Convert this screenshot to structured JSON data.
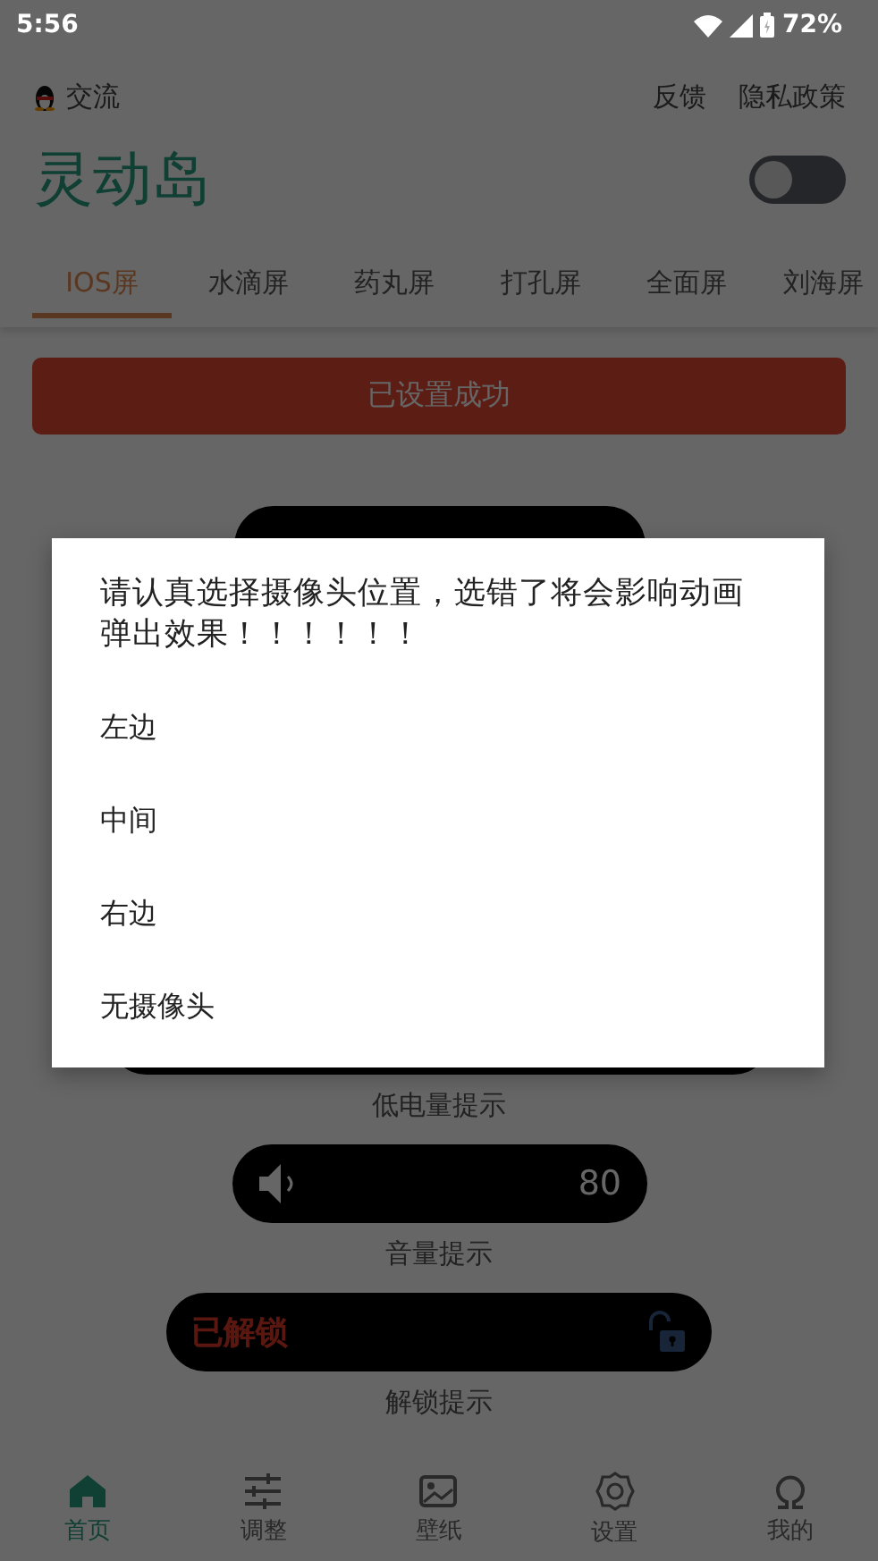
{
  "status_bar": {
    "time": "5:56",
    "battery": "72%"
  },
  "header": {
    "community": "交流",
    "links": [
      "反馈",
      "隐私政策"
    ]
  },
  "app_title": "灵动岛",
  "main_switch": {
    "on": false
  },
  "tabs": [
    {
      "label": "IOS屏",
      "selected": true
    },
    {
      "label": "水滴屏",
      "selected": false
    },
    {
      "label": "药丸屏",
      "selected": false
    },
    {
      "label": "打孔屏",
      "selected": false
    },
    {
      "label": "全面屏",
      "selected": false
    },
    {
      "label": "刘海屏",
      "selected": false
    }
  ],
  "action_button": "已设置成功",
  "previews": [
    {
      "kind": "blank"
    },
    {
      "kind": "blank",
      "caption": "低电量提示"
    },
    {
      "kind": "volume",
      "value": "80",
      "caption": "音量提示"
    },
    {
      "kind": "unlock",
      "text": "已解锁",
      "caption": "解锁提示"
    }
  ],
  "dialog": {
    "message": "请认真选择摄像头位置，选错了将会影响动画弹出效果！！！！！！",
    "options": [
      "左边",
      "中间",
      "右边",
      "无摄像头"
    ]
  },
  "bottom_nav": [
    {
      "kind": "home",
      "label": "首页",
      "selected": true
    },
    {
      "kind": "adjust",
      "label": "调整",
      "selected": false
    },
    {
      "kind": "wallpaper",
      "label": "壁纸",
      "selected": false
    },
    {
      "kind": "settings",
      "label": "设置",
      "selected": false
    },
    {
      "kind": "mine",
      "label": "我的",
      "selected": false
    }
  ]
}
